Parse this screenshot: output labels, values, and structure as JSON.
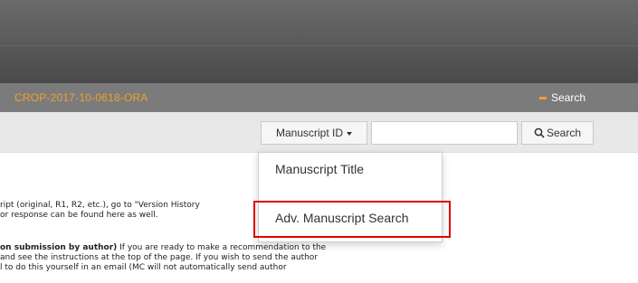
{
  "header": {
    "manuscript_id": "CROP-2017-10-0618-ORA",
    "search_toggle_label": "Search"
  },
  "search_bar": {
    "field_selector_label": "Manuscript ID",
    "input_value": "",
    "input_placeholder": "",
    "search_button_label": "Search"
  },
  "field_dropdown": {
    "options": [
      {
        "label": "Manuscript Title"
      },
      {
        "label": "Adv. Manuscript Search"
      }
    ]
  },
  "content": {
    "line1": "ript (original, R1, R2, etc.), go to \"Version History",
    "line2": "or response can be found here as well.",
    "line3_bold": "on submission by author)",
    "line3_rest": " If you are ready to make a recommendation to the",
    "line4": "and see the instructions at the top of the page. If you wish to send the author",
    "line5": "l to do this yourself in an email (MC will not automatically send author"
  },
  "colors": {
    "accent_orange": "#f0a030",
    "highlight_red": "#e00000"
  }
}
